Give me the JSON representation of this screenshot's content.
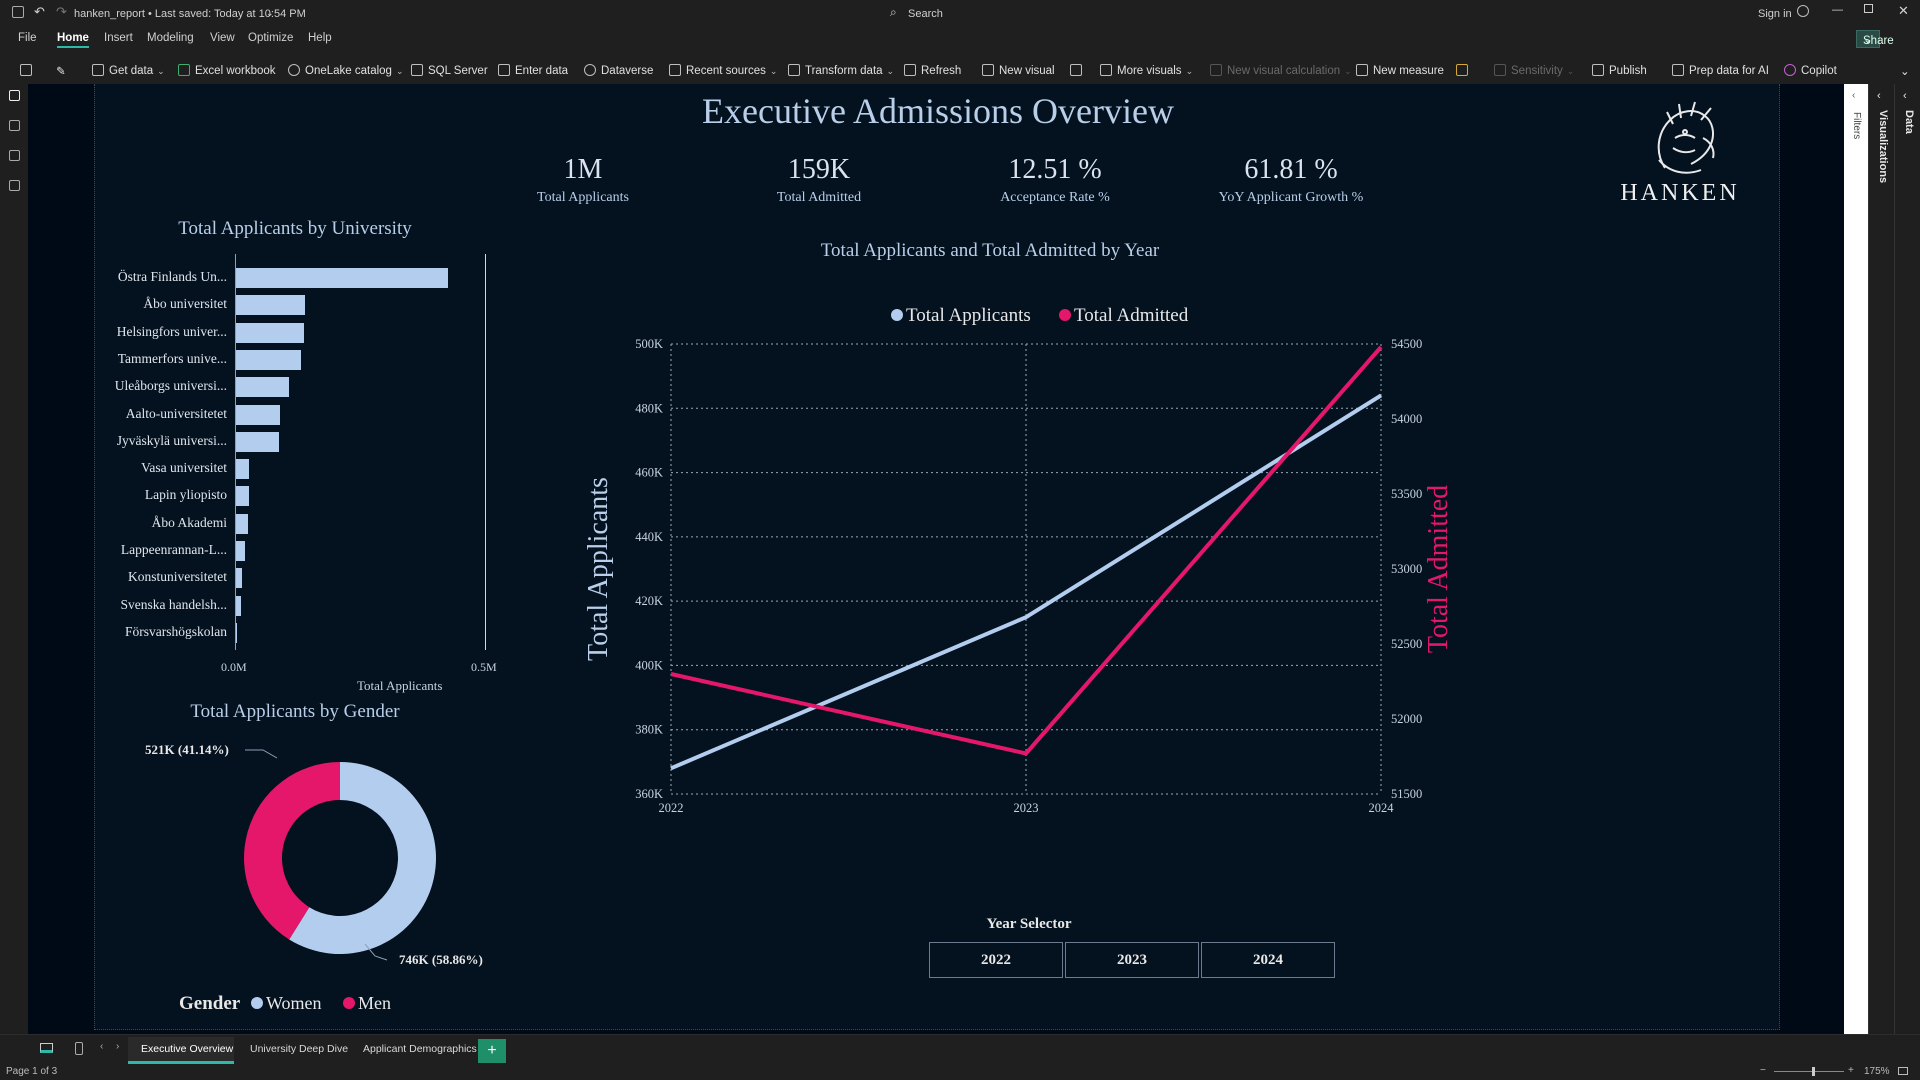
{
  "window": {
    "doc_title": "hanken_report • Last saved: Today at 10:54 PM",
    "search_placeholder": "Search",
    "sign_in": "Sign in",
    "share": "Share"
  },
  "menu": [
    "File",
    "Home",
    "Insert",
    "Modeling",
    "View",
    "Optimize",
    "Help"
  ],
  "ribbon": {
    "get_data": "Get data",
    "excel": "Excel workbook",
    "onelake": "OneLake catalog",
    "sql": "SQL Server",
    "enter_data": "Enter data",
    "dataverse": "Dataverse",
    "recent": "Recent sources",
    "transform": "Transform data",
    "refresh": "Refresh",
    "new_visual": "New visual",
    "more_visuals": "More visuals",
    "new_visual_calc": "New visual calculation",
    "new_measure": "New measure",
    "sensitivity": "Sensitivity",
    "publish": "Publish",
    "prep_ai": "Prep data for AI",
    "copilot": "Copilot"
  },
  "report": {
    "title": "Executive Admissions Overview",
    "logo_text": "HANKEN",
    "kpis": [
      {
        "value": "1M",
        "label": "Total Applicants"
      },
      {
        "value": "159K",
        "label": "Total Admitted"
      },
      {
        "value": "12.51 %",
        "label": "Acceptance Rate %"
      },
      {
        "value": "61.81 %",
        "label": "YoY Applicant Growth %"
      }
    ],
    "year_selector": {
      "title": "Year Selector",
      "options": [
        "2022",
        "2023",
        "2024"
      ]
    }
  },
  "chart_data": [
    {
      "type": "bar",
      "title": "Total Applicants by University",
      "xlabel": "Total Applicants",
      "xlim": [
        0,
        0.5
      ],
      "x_ticks": [
        "0.0M",
        "0.5M"
      ],
      "categories": [
        "Östra Finlands Un...",
        "Åbo universitet",
        "Helsingfors univer...",
        "Tammerfors unive...",
        "Uleåborgs universi...",
        "Aalto-universitetet",
        "Jyväskylä universi...",
        "Vasa universitet",
        "Lapin yliopisto",
        "Åbo Akademi",
        "Lappeenrannan-L...",
        "Konstuniversitetet",
        "Svenska handelsh...",
        "Försvarshögskolan"
      ],
      "values": [
        0.425,
        0.14,
        0.138,
        0.132,
        0.108,
        0.09,
        0.087,
        0.028,
        0.027,
        0.025,
        0.019,
        0.013,
        0.011,
        0.004
      ],
      "color": "#b3cdee"
    },
    {
      "type": "pie",
      "title": "Total Applicants by Gender",
      "legend_title": "Gender",
      "legend_position": "bottom",
      "labels": [
        "Women",
        "Men"
      ],
      "values": [
        746,
        521
      ],
      "data_labels": [
        "746K (58.86%)",
        "521K (41.14%)"
      ],
      "colors": [
        "#b3cdee",
        "#e5176b"
      ]
    },
    {
      "type": "line",
      "title": "Total Applicants and Total Admitted by Year",
      "legend_position": "top",
      "x": [
        2022,
        2023,
        2024
      ],
      "x_ticks": [
        "2022",
        "2023",
        "2024"
      ],
      "ylabel": "Total Applicants",
      "ylabel_right": "Total Admitted",
      "ylim": [
        360000,
        500000
      ],
      "ylim_right": [
        51500,
        54500
      ],
      "y_ticks": [
        "360K",
        "380K",
        "400K",
        "420K",
        "440K",
        "460K",
        "480K",
        "500K"
      ],
      "y_ticks_right": [
        "51500",
        "52000",
        "52500",
        "53000",
        "53500",
        "54000",
        "54500"
      ],
      "series": [
        {
          "name": "Total Applicants",
          "axis": "left",
          "values": [
            368000,
            415000,
            484000
          ],
          "color": "#b3cdee"
        },
        {
          "name": "Total Admitted",
          "axis": "right",
          "values": [
            52300,
            51770,
            54480
          ],
          "color": "#e5176b"
        }
      ]
    }
  ],
  "tabs": [
    "Executive Overview",
    "University Deep Dive",
    "Applicant Demographics"
  ],
  "status": {
    "page": "Page 1 of 3",
    "zoom": "175%"
  },
  "panes": {
    "filters": "Filters",
    "visualizations": "Visualizations",
    "data": "Data"
  }
}
